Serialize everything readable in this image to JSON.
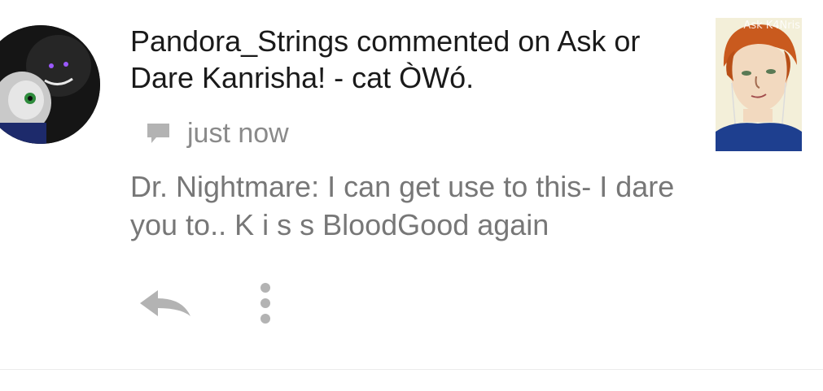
{
  "notification": {
    "title": "Pandora_Strings commented on Ask or Dare Kanrisha! - cat ÒWó.",
    "timestamp": "just now",
    "comment_text": "Dr. Nightmare: I can get use to this- I dare you to.. K i s s BloodGood again",
    "thumbnail_watermark": "Ask K4Nris",
    "icons": {
      "comment": "comment-bubble-icon",
      "reply": "reply-arrow-icon",
      "more": "more-vertical-icon"
    },
    "colors": {
      "title": "#1a1a1a",
      "meta": "#8a8a8a",
      "body": "#777777",
      "icons": "#b3b3b3"
    }
  }
}
